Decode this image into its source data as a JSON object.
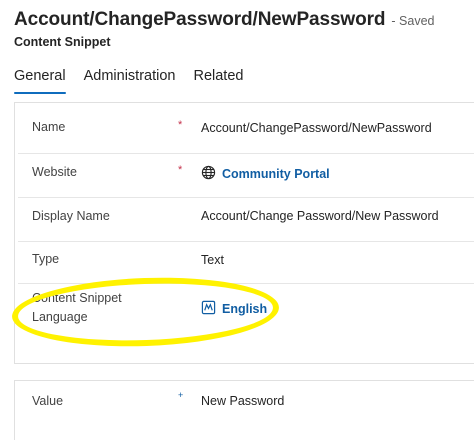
{
  "header": {
    "title": "Account/ChangePassword/NewPassword",
    "saved_status": "- Saved",
    "entity_type": "Content Snippet"
  },
  "tabs": [
    {
      "label": "General",
      "active": true
    },
    {
      "label": "Administration",
      "active": false
    },
    {
      "label": "Related",
      "active": false
    }
  ],
  "fields": {
    "name": {
      "label": "Name",
      "required_marker": "*",
      "value": "Account/ChangePassword/NewPassword"
    },
    "website": {
      "label": "Website",
      "required_marker": "*",
      "value": "Community Portal",
      "icon": "globe-icon"
    },
    "display_name": {
      "label": "Display Name",
      "value": "Account/Change Password/New Password"
    },
    "type": {
      "label": "Type",
      "value": "Text"
    },
    "language": {
      "label_line1": "Content Snippet",
      "label_line2": "Language",
      "value": "English",
      "icon": "language-record-icon"
    },
    "value": {
      "label": "Value",
      "required_marker": "+",
      "value": "New Password"
    }
  },
  "colors": {
    "accent": "#0f6cbd",
    "link": "#115ea3",
    "required": "#c4314b",
    "highlight": "#fff200"
  }
}
